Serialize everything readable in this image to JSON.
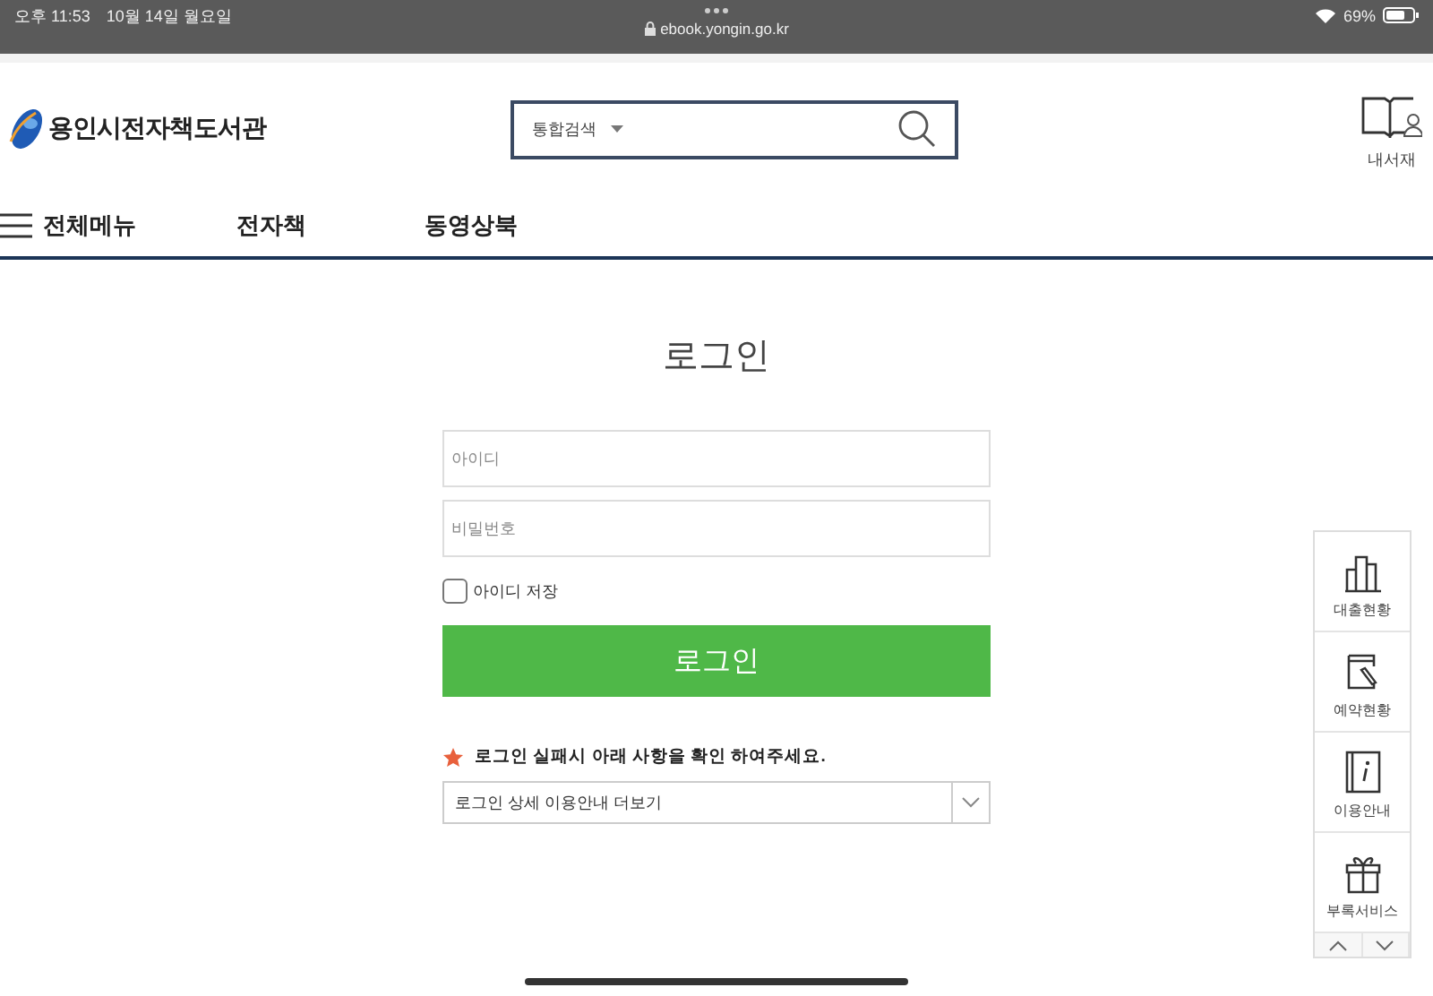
{
  "status_bar": {
    "time": "오후 11:53",
    "date": "10월 14일 월요일",
    "url": "ebook.yongin.go.kr",
    "battery": "69%"
  },
  "header": {
    "logo": "용인시전자책도서관",
    "search": {
      "scope": "통합검색"
    },
    "my_library": "내서재"
  },
  "nav": {
    "all_menu": "전체메뉴",
    "items": [
      "전자책",
      "동영상북"
    ]
  },
  "login": {
    "title": "로그인",
    "id_field": {
      "placeholder": "아이디"
    },
    "password_field": {
      "placeholder": "비밀번호"
    },
    "save_id": {
      "label": "아이디 저장",
      "checked": false
    },
    "button": "로그인",
    "notice": "로그인 실패시 아래 사항을 확인 하여주세요.",
    "help_select": "로그인 상세 이용안내 더보기"
  },
  "quick_menu": [
    {
      "kind": "chart",
      "label": "대출현황"
    },
    {
      "kind": "reserve",
      "label": "예약현황"
    },
    {
      "kind": "info",
      "label": "이용안내"
    },
    {
      "kind": "gift",
      "label": "부록서비스"
    }
  ]
}
